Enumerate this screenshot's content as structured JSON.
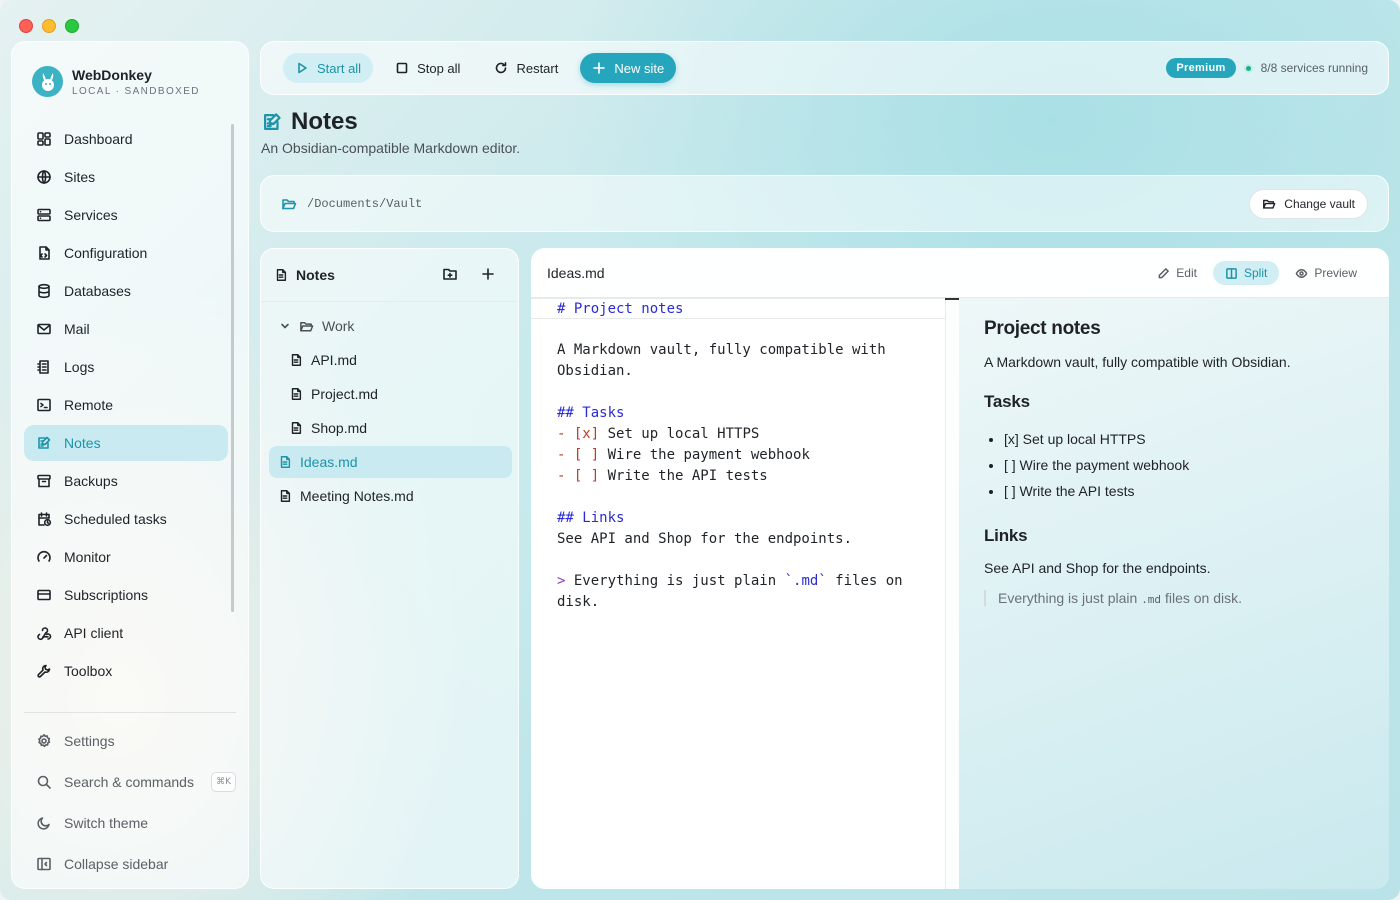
{
  "window": {
    "traffic_lights": [
      "close",
      "minimize",
      "zoom"
    ]
  },
  "brand": {
    "name": "WebDonkey",
    "subtitle": "LOCAL · SANDBOXED",
    "logo_icon": "donkey-icon"
  },
  "sidebar": {
    "items": [
      {
        "label": "Dashboard",
        "icon": "dashboard-icon"
      },
      {
        "label": "Sites",
        "icon": "globe-icon"
      },
      {
        "label": "Services",
        "icon": "server-icon"
      },
      {
        "label": "Configuration",
        "icon": "config-file-icon"
      },
      {
        "label": "Databases",
        "icon": "database-icon"
      },
      {
        "label": "Mail",
        "icon": "mail-icon"
      },
      {
        "label": "Logs",
        "icon": "logs-icon"
      },
      {
        "label": "Remote",
        "icon": "terminal-icon"
      },
      {
        "label": "Notes",
        "icon": "notes-icon",
        "active": true
      },
      {
        "label": "Backups",
        "icon": "archive-icon"
      },
      {
        "label": "Scheduled tasks",
        "icon": "calendar-clock-icon"
      },
      {
        "label": "Monitor",
        "icon": "gauge-icon"
      },
      {
        "label": "Subscriptions",
        "icon": "credit-card-icon"
      },
      {
        "label": "API client",
        "icon": "webhook-icon"
      },
      {
        "label": "Toolbox",
        "icon": "wrench-icon"
      }
    ],
    "bottom": [
      {
        "label": "Settings",
        "icon": "gear-icon"
      },
      {
        "label": "Search & commands",
        "icon": "search-icon",
        "shortcut": "⌘K"
      },
      {
        "label": "Switch theme",
        "icon": "moon-icon"
      },
      {
        "label": "Collapse sidebar",
        "icon": "sidebar-collapse-icon"
      }
    ]
  },
  "toolbar": {
    "start_all": "Start all",
    "stop_all": "Stop all",
    "restart": "Restart",
    "new_site": "New site",
    "badge": "Premium",
    "status": "8/8 services running",
    "status_color": "#1bb08a",
    "accent": "#26a6bd"
  },
  "page": {
    "title": "Notes",
    "subtitle": "An Obsidian-compatible Markdown editor."
  },
  "vault": {
    "path": "/Documents/Vault",
    "change_label": "Change vault"
  },
  "tree": {
    "title": "Notes",
    "folder": "Work",
    "children": [
      "API.md",
      "Project.md",
      "Shop.md"
    ],
    "files": [
      "Ideas.md",
      "Meeting Notes.md"
    ],
    "active": "Ideas.md"
  },
  "editor": {
    "filename": "Ideas.md",
    "modes": {
      "edit": "Edit",
      "split": "Split",
      "preview": "Preview",
      "active": "Split"
    },
    "source": {
      "l1": "# Project notes",
      "l3": "A Markdown vault, fully compatible with",
      "l4": "Obsidian.",
      "l6": "## Tasks",
      "t1_mark": "[x]",
      "t1_text": "Set up local HTTPS",
      "t2_mark": "[ ]",
      "t2_text": "Wire the payment webhook",
      "t3_mark": "[ ]",
      "t3_text": "Write the API tests",
      "l11": "## Links",
      "l12": "See API and Shop for the endpoints.",
      "q_prefix": ">",
      "q_text1": " Everything is just plain ",
      "q_code": "`.md`",
      "q_text2": " files on",
      "q_line2": "disk."
    },
    "preview": {
      "h1": "Project notes",
      "intro": "A Markdown vault, fully compatible with Obsidian.",
      "h2_tasks": "Tasks",
      "tasks": [
        "[x] Set up local HTTPS",
        "[ ] Wire the payment webhook",
        "[ ] Write the API tests"
      ],
      "h2_links": "Links",
      "links_text": "See API and Shop for the endpoints.",
      "quote_a": "Everything is just plain ",
      "quote_code": ".md",
      "quote_b": " files on disk."
    }
  }
}
